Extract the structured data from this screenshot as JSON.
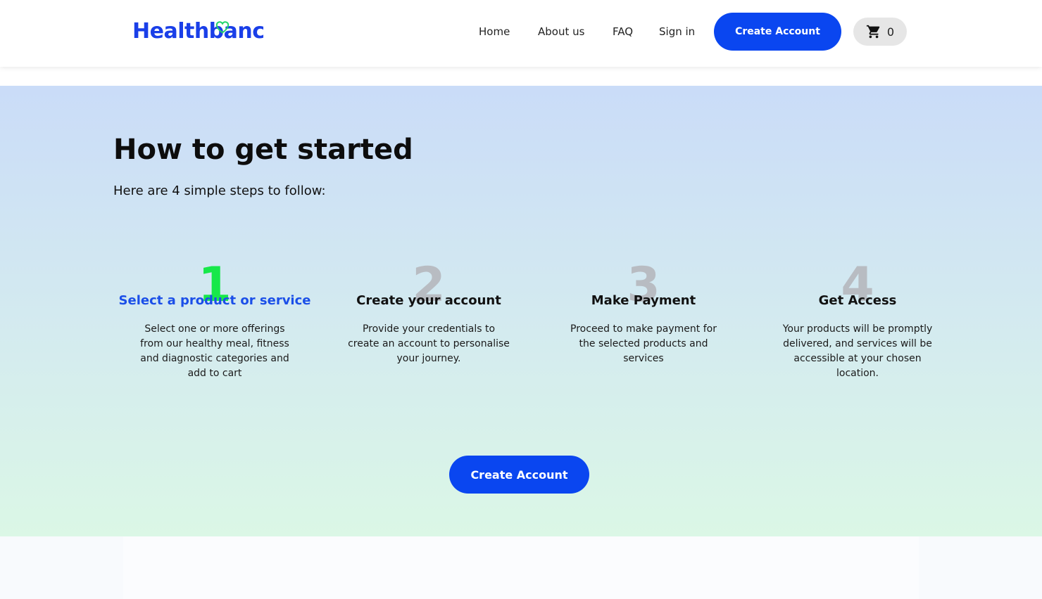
{
  "header": {
    "logo_text": "Healthbanc",
    "nav": [
      "Home",
      "About us",
      "FAQ",
      "Sign in"
    ],
    "cta_label": "Create Account",
    "cart_count": "0",
    "icons": {
      "logo": "heart-icon",
      "cart": "cart-icon"
    }
  },
  "hero": {
    "title": "How to get started",
    "subtitle": "Here are 4 simple steps to follow:",
    "steps": [
      {
        "number": "1",
        "title": "Select a product or service",
        "description": "Select one or more offerings from our healthy meal, fitness and diagnostic categories and add to cart"
      },
      {
        "number": "2",
        "title": "Create your account",
        "description": "Provide your credentials to create an account to personalise your journey."
      },
      {
        "number": "3",
        "title": "Make Payment",
        "description": "Proceed to make payment for the selected products and services"
      },
      {
        "number": "4",
        "title": "Get Access",
        "description": "Your products will be promptly delivered, and services will be accessible at your chosen location."
      }
    ],
    "cta_label": "Create Account"
  },
  "colors": {
    "brand_blue": "#0a46f0",
    "logo_blue": "#1a3fe8",
    "active_step_number": "#17e84a",
    "active_step_title": "#1b4fe8",
    "inactive_step_number": "#b8bcc2"
  }
}
